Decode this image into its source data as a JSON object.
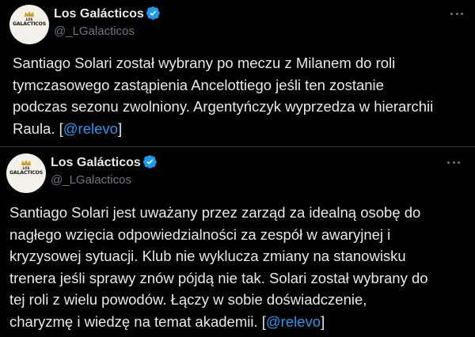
{
  "colors": {
    "background": "#000000",
    "text": "#e7e9ea",
    "muted": "#71767b",
    "link": "#1d9bf0",
    "verified": "#1d9bf0",
    "divider": "#2f3336"
  },
  "avatar_logo": {
    "top_text": "LOS",
    "main_text": "GALÁCTICOS"
  },
  "tweets": [
    {
      "author": {
        "display_name": "Los Galácticos",
        "handle": "@_LGalacticos",
        "verified": true
      },
      "more_icon": "ellipsis-icon",
      "lines": [
        "Santiago Solari został wybrany po meczu z Milanem do roli",
        "tymczasowego zastąpienia Ancelottiego jeśli ten zostanie",
        "podczas sezonu zwolniony. Argentyńczyk wyprzedza w hierarchii"
      ],
      "last_line_prefix": "Raula. [",
      "last_line_link": "@relevo",
      "last_line_suffix": "]"
    },
    {
      "author": {
        "display_name": "Los Galácticos",
        "handle": "@_LGalacticos",
        "verified": true
      },
      "more_icon": "ellipsis-icon",
      "lines": [
        "Santiago Solari jest uważany przez zarząd za idealną osobę do",
        "nagłego wzięcia odpowiedzialności za zespół w awaryjnej i",
        "kryzysowej sytuacji. Klub nie wyklucza zmiany na stanowisku",
        "trenera jeśli sprawy znów pójdą nie tak. Solari został wybrany do",
        "tej roli z wielu powodów. Łączy w sobie doświadczenie,"
      ],
      "last_line_prefix": "charyzmę i wiedzę na temat akademii. [",
      "last_line_link": "@relevo",
      "last_line_suffix": "]"
    }
  ]
}
